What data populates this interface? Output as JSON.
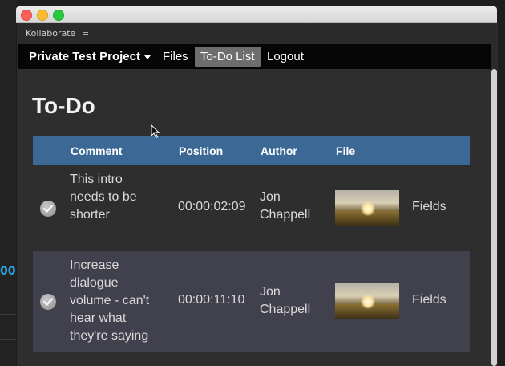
{
  "window": {
    "panel_title": "Kollaborate",
    "menu_glyph": "≡"
  },
  "background": {
    "timecode_fragment": "00:"
  },
  "navbar": {
    "project": "Private Test Project",
    "items": [
      "Files",
      "To-Do List",
      "Logout"
    ],
    "active_item": "To-Do List"
  },
  "page": {
    "title": "To-Do"
  },
  "table": {
    "columns": [
      "Comment",
      "Position",
      "Author",
      "File"
    ],
    "rows": [
      {
        "comment": [
          "This intro",
          "needs to be",
          "shorter"
        ],
        "position": "00:00:02:09",
        "author": [
          "Jon",
          "Chappell"
        ],
        "file": "Fields",
        "done": true
      },
      {
        "comment": [
          "Increase",
          "dialogue",
          "volume - can't",
          "hear what",
          "they're saying"
        ],
        "position": "00:00:11:10",
        "author": [
          "Jon",
          "Chappell"
        ],
        "file": "Fields",
        "done": true
      }
    ]
  },
  "colors": {
    "header_bg": "#3c6896",
    "navbar_bg": "#060606",
    "active_nav_bg": "#6e6e6e",
    "alt_row_bg": "#41414d",
    "timecode_blue": "#2aa4e0"
  }
}
